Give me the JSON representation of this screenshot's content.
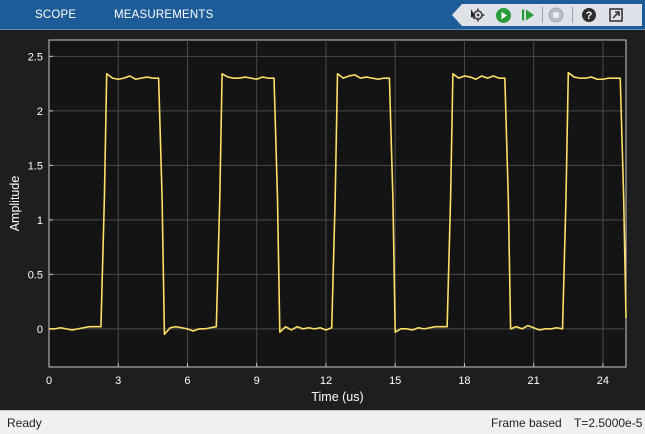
{
  "toolbar": {
    "tabs": [
      {
        "label": "SCOPE"
      },
      {
        "label": "MEASUREMENTS"
      }
    ],
    "icons": [
      "cursor-gear-icon",
      "run-icon",
      "step-forward-icon",
      "stop-icon",
      "help-icon",
      "undock-icon"
    ],
    "help_glyph": "?"
  },
  "colors": {
    "toolbar_bg": "#1d5b99",
    "plot_bg": "#141414",
    "signal": "#ffe066",
    "run_green": "#2a9d3a"
  },
  "chart_data": {
    "type": "line",
    "title": "",
    "xlabel": "Time (us)",
    "ylabel": "Amplitude",
    "xlim": [
      0,
      25
    ],
    "ylim": [
      -0.35,
      2.65
    ],
    "xticks": [
      0,
      3,
      6,
      9,
      12,
      15,
      18,
      21,
      24
    ],
    "yticks": [
      0,
      0.5,
      1,
      1.5,
      2,
      2.5
    ],
    "grid": true,
    "legend": "none",
    "series": [
      {
        "color": "#ffe066",
        "x": [
          0,
          0.25,
          0.5,
          0.75,
          1,
          1.25,
          1.5,
          1.75,
          2,
          2.25,
          2.4,
          2.5,
          2.75,
          3,
          3.25,
          3.5,
          3.75,
          4,
          4.25,
          4.5,
          4.75,
          4.9,
          5,
          5.25,
          5.5,
          5.75,
          6,
          6.25,
          6.5,
          6.75,
          7,
          7.25,
          7.4,
          7.5,
          7.75,
          8,
          8.25,
          8.5,
          8.75,
          9,
          9.25,
          9.5,
          9.75,
          9.9,
          10,
          10.25,
          10.5,
          10.75,
          11,
          11.25,
          11.5,
          11.75,
          12,
          12.25,
          12.4,
          12.5,
          12.75,
          13,
          13.25,
          13.5,
          13.75,
          14,
          14.25,
          14.5,
          14.75,
          14.9,
          15,
          15.25,
          15.5,
          15.75,
          16,
          16.25,
          16.5,
          16.75,
          17,
          17.25,
          17.4,
          17.5,
          17.75,
          18,
          18.25,
          18.5,
          18.75,
          19,
          19.25,
          19.5,
          19.75,
          19.9,
          20,
          20.25,
          20.5,
          20.75,
          21,
          21.25,
          21.5,
          21.75,
          22,
          22.25,
          22.4,
          22.5,
          22.75,
          23,
          23.25,
          23.5,
          23.75,
          24,
          24.25,
          24.5,
          24.75,
          24.9,
          25
        ],
        "y": [
          0,
          0,
          0.01,
          0,
          -0.01,
          0,
          0.01,
          0.02,
          0.02,
          0.02,
          1.2,
          2.34,
          2.3,
          2.29,
          2.3,
          2.32,
          2.29,
          2.3,
          2.31,
          2.3,
          2.3,
          1.2,
          -0.05,
          0.01,
          0.02,
          0.01,
          0,
          -0.02,
          0,
          0,
          0.01,
          0.02,
          1.2,
          2.34,
          2.31,
          2.3,
          2.3,
          2.31,
          2.3,
          2.29,
          2.31,
          2.3,
          2.3,
          1.2,
          -0.03,
          0.02,
          -0.01,
          0.02,
          0,
          0.01,
          0,
          0.01,
          -0.01,
          0.01,
          1.2,
          2.34,
          2.3,
          2.32,
          2.33,
          2.3,
          2.31,
          2.3,
          2.29,
          2.3,
          2.3,
          1.2,
          -0.03,
          0,
          0,
          -0.01,
          0.01,
          0,
          0.01,
          0.02,
          0.02,
          0.02,
          1.2,
          2.34,
          2.3,
          2.32,
          2.31,
          2.29,
          2.32,
          2.3,
          2.32,
          2.3,
          2.3,
          1.2,
          0,
          0.02,
          0,
          0.03,
          0.01,
          -0.01,
          0,
          0,
          0.01,
          0,
          1.2,
          2.35,
          2.31,
          2.3,
          2.3,
          2.31,
          2.29,
          2.29,
          2.3,
          2.3,
          2.3,
          1.2,
          0.1
        ]
      }
    ]
  },
  "status": {
    "left": "Ready",
    "mode": "Frame based",
    "time": "T=2.5000e-5"
  }
}
